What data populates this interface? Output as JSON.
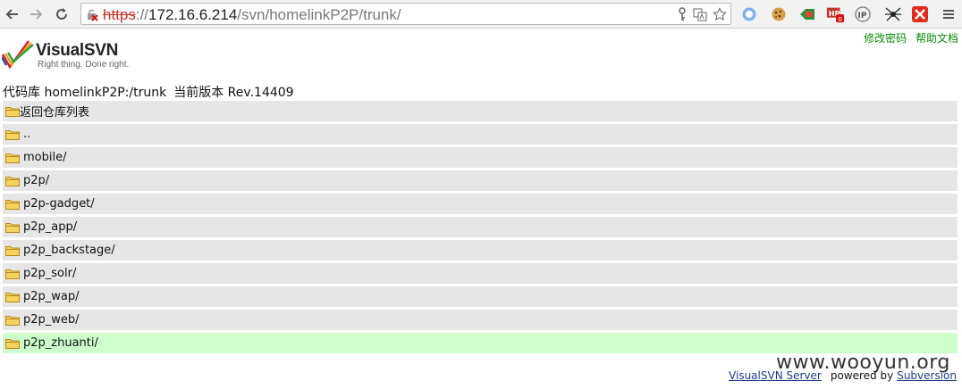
{
  "browser": {
    "url_scheme": "https",
    "url_sep": "://",
    "url_host": "172.16.6.214",
    "url_path": "/svn/homelinkP2P/trunk/",
    "icons": [
      "back-icon",
      "forward-icon",
      "reload-icon",
      "insecure-lock-icon",
      "key-icon",
      "translate-icon",
      "bookmark-star-icon",
      "extension-circle-icon",
      "cookie-icon",
      "extension-tag-icon",
      "ip-badge-icon",
      "ip-icon",
      "spider-icon",
      "close-ext-icon",
      "menu-icon"
    ],
    "ext_badge": "0"
  },
  "toplinks": {
    "change_password": "修改密码",
    "help": "帮助文档"
  },
  "logo": {
    "name": "VisualSVN",
    "tagline": "Right thing. Done right."
  },
  "heading": {
    "repo": "代码库 homelinkP2P:/trunk",
    "revision": "当前版本 Rev.14409"
  },
  "listing": {
    "rows": [
      "返回仓库列表",
      "..",
      "mobile/",
      "p2p/",
      "p2p-gadget/",
      "p2p_app/",
      "p2p_backstage/",
      "p2p_solr/",
      "p2p_wap/",
      "p2p_web/",
      "p2p_zhuanti/"
    ]
  },
  "footer": {
    "server_link": "VisualSVN Server",
    "powered_by": "powered by",
    "subversion_link": "Subversion",
    "watermark": "www.wooyun.org"
  },
  "colors": {
    "row_bg": "#e6e6e6",
    "highlight_bg": "#ccffcc",
    "link_green": "#0a8a0a",
    "link_blue": "#1a3c8a"
  }
}
